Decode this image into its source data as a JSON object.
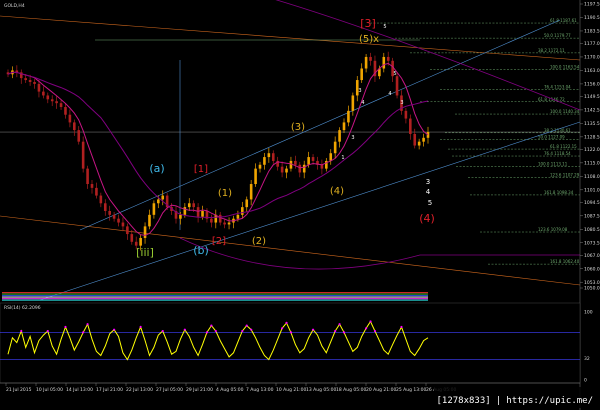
{
  "colors": {
    "background": "#000000",
    "bull": "#f0a500",
    "bear": "#b02020",
    "ma_magenta": "#c71585",
    "ma_purple": "#800080",
    "channel_blue": "#4f8fd0",
    "trend_orange": "#d2691e",
    "fib_green": "#6ea86e",
    "rsi_line": "#ffff00",
    "rsi_overbought": "#ff00ff",
    "rsi_band": "#4040ff"
  },
  "chart_data": [
    {
      "type": "candlestick",
      "title": "GOLD,H4",
      "symbol_label": "GOLD,H4",
      "y_ticks": [
        "1197.5",
        "1190.5",
        "1183.5",
        "1177.0",
        "1170.0",
        "1163.0",
        "1156.0",
        "1149.5",
        "1142.5",
        "1135.5",
        "1128.5",
        "1122.0",
        "1115.0",
        "1108.0",
        "1101.0",
        "1094.5",
        "1087.5",
        "1080.5",
        "1073.5",
        "1067.0",
        "1060.0",
        "1053.0",
        "1050.0"
      ],
      "ylim": [
        1050.0,
        1197.5
      ],
      "x_ticks": [
        "21 Jul 2015",
        "10 Jul 05:00",
        "14 Jul 13:00",
        "17 Jul 21:00",
        "22 Jul 13:00",
        "27 Jul 05:00",
        "29 Jul 21:00",
        "4 Aug 05:00",
        "7 Aug 13:00",
        "10 Aug 21:00",
        "13 Aug 05:00",
        "18 Aug 05:00",
        "20 Aug 21:00",
        "25 Aug 13:00",
        "26 Aug 05:00"
      ],
      "close_series": [
        1161,
        1163,
        1162,
        1159,
        1158,
        1157,
        1156,
        1152,
        1150,
        1148,
        1147,
        1146,
        1144,
        1140,
        1136,
        1132,
        1126,
        1112,
        1104,
        1102,
        1098,
        1094,
        1090,
        1088,
        1086,
        1084,
        1082,
        1078,
        1074,
        1072,
        1076,
        1082,
        1088,
        1094,
        1096,
        1098,
        1092,
        1090,
        1086,
        1088,
        1092,
        1094,
        1092,
        1087,
        1090,
        1086,
        1084,
        1088,
        1084,
        1083,
        1084,
        1086,
        1088,
        1092,
        1096,
        1104,
        1112,
        1114,
        1118,
        1120,
        1116,
        1113,
        1110,
        1112,
        1116,
        1114,
        1110,
        1114,
        1118,
        1116,
        1114,
        1112,
        1116,
        1120,
        1126,
        1132,
        1136,
        1142,
        1150,
        1158,
        1164,
        1170,
        1168,
        1160,
        1164,
        1170,
        1168,
        1160,
        1150,
        1142,
        1138,
        1130,
        1124,
        1126,
        1128,
        1131
      ],
      "wave_labels": [
        {
          "text": "[iii]",
          "color": "#9acd32"
        },
        {
          "text": "(a)",
          "color": "#3fb8e8"
        },
        {
          "text": "(b)",
          "color": "#3fb8e8"
        },
        {
          "text": "[1]",
          "color": "#e0202a"
        },
        {
          "text": "[2]",
          "color": "#e0202a"
        },
        {
          "text": "(1)",
          "color": "#e0b020"
        },
        {
          "text": "(2)",
          "color": "#e0b020"
        },
        {
          "text": "(3)",
          "color": "#e0b020"
        },
        {
          "text": "(4)",
          "color": "#e0b020"
        },
        {
          "text": "(5)x",
          "color": "#e0b020"
        },
        {
          "text": "[3]",
          "color": "#e0202a"
        },
        {
          "text": "(4)",
          "color": "#e0202a"
        },
        {
          "text": "3",
          "color": "#ffffff"
        },
        {
          "text": "4",
          "color": "#ffffff"
        },
        {
          "text": "5",
          "color": "#ffffff"
        }
      ],
      "fib_levels": [
        "61.8  1187.61",
        "50.0  1179.77",
        "38.2  1172.11",
        "100.0  1163.54",
        "76.4  1153.04",
        "61.8  1146.72",
        "100.0  1140.34",
        "38.2  1130.61",
        "50.0  1127.09",
        "61.8  1122.15",
        "76.4  1118.54",
        "100.0  1113.11",
        "123.6  1107.29",
        "161.8  1098.34",
        "123.6  1079.08",
        "161.8  1062.40"
      ]
    },
    {
      "type": "line",
      "title": "RSI(14) 62.2096",
      "y_ticks": [
        "100",
        "32",
        "0"
      ],
      "ylim": [
        0,
        100
      ],
      "values": [
        38,
        62,
        55,
        72,
        48,
        64,
        40,
        58,
        66,
        72,
        50,
        38,
        60,
        78,
        62,
        44,
        56,
        70,
        82,
        60,
        42,
        36,
        50,
        68,
        74,
        64,
        40,
        30,
        44,
        62,
        78,
        58,
        36,
        48,
        66,
        72,
        56,
        38,
        42,
        60,
        74,
        64,
        48,
        36,
        52,
        70,
        80,
        72,
        58,
        46,
        34,
        40,
        56,
        72,
        80,
        74,
        62,
        48,
        36,
        30,
        44,
        60,
        76,
        84,
        70,
        52,
        40,
        46,
        62,
        74,
        66,
        50,
        40,
        56,
        72,
        82,
        70,
        56,
        42,
        48,
        64,
        76,
        86,
        72,
        58,
        44,
        38,
        52,
        66,
        78,
        60,
        42,
        36,
        46,
        58,
        62
      ]
    }
  ],
  "watermark": "[1278x833]",
  "watermark_url": "https://upic.me/"
}
